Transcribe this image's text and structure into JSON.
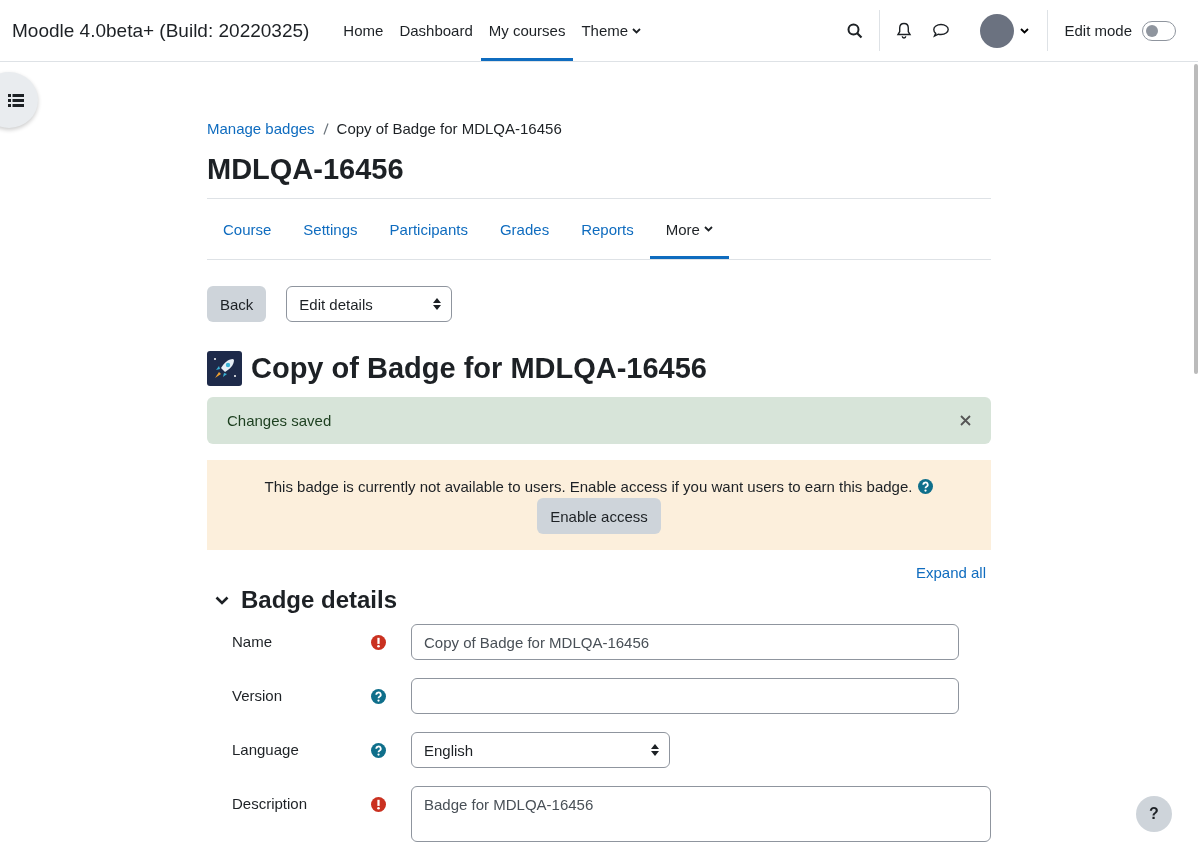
{
  "navbar": {
    "brand": "Moodle 4.0beta+ (Build: 20220325)",
    "items": [
      {
        "label": "Home",
        "selected": false,
        "dropdown": false
      },
      {
        "label": "Dashboard",
        "selected": false,
        "dropdown": false
      },
      {
        "label": "My courses",
        "selected": true,
        "dropdown": false
      },
      {
        "label": "Theme",
        "selected": false,
        "dropdown": true
      }
    ],
    "edit_mode": {
      "label": "Edit mode",
      "on": false
    }
  },
  "breadcrumb": [
    {
      "label": "Manage badges",
      "link": true
    },
    {
      "label": "Copy of Badge for MDLQA-16456",
      "link": false
    }
  ],
  "course_title": "MDLQA-16456",
  "secondary_nav": [
    {
      "label": "Course",
      "selected": false,
      "dropdown": false
    },
    {
      "label": "Settings",
      "selected": false,
      "dropdown": false
    },
    {
      "label": "Participants",
      "selected": false,
      "dropdown": false
    },
    {
      "label": "Grades",
      "selected": false,
      "dropdown": false
    },
    {
      "label": "Reports",
      "selected": false,
      "dropdown": false
    },
    {
      "label": "More",
      "selected": true,
      "dropdown": true
    }
  ],
  "action_bar": {
    "back": "Back",
    "select": "Edit details"
  },
  "badge_title": "Copy of Badge for MDLQA-16456",
  "alert": {
    "text": "Changes saved"
  },
  "notice": {
    "text": "This badge is currently not available to users. Enable access if you want users to earn this badge.",
    "button": "Enable access"
  },
  "expand_all": "Expand all",
  "section": {
    "title": "Badge details",
    "expanded": true,
    "fields": [
      {
        "label": "Name",
        "kind": "text",
        "required": true,
        "value": "Copy of Badge for MDLQA-16456"
      },
      {
        "label": "Version",
        "kind": "text",
        "required": false
      },
      {
        "label": "Language",
        "kind": "select",
        "required": false,
        "value": "English"
      },
      {
        "label": "Description",
        "kind": "textarea",
        "required": true,
        "value": "Badge for MDLQA-16456"
      }
    ]
  },
  "help_button": "?"
}
